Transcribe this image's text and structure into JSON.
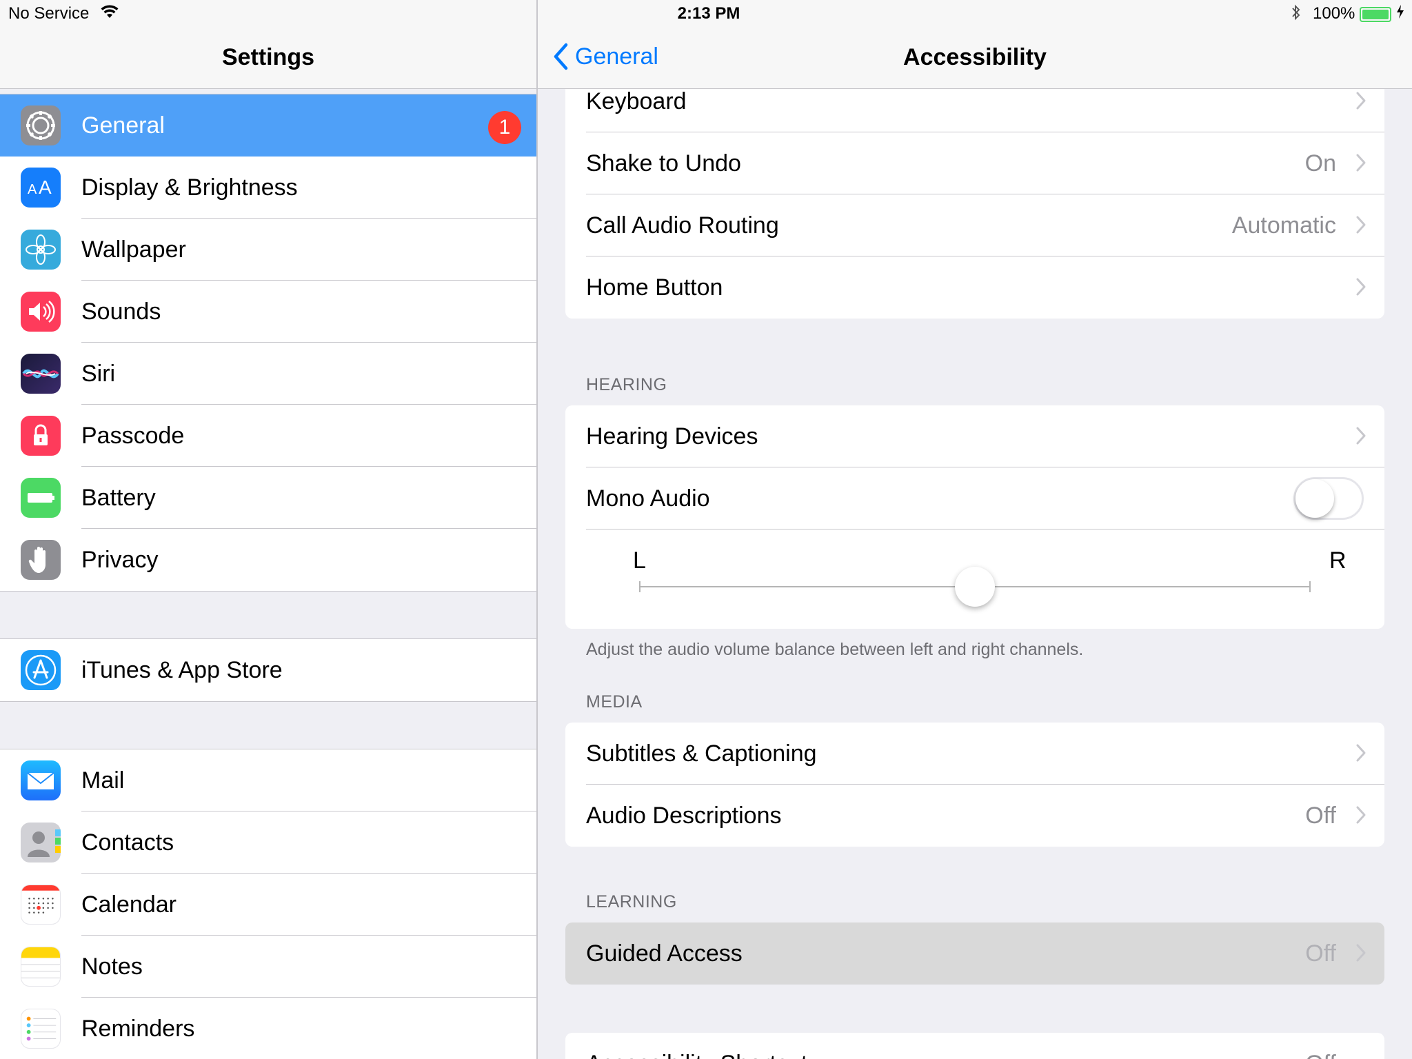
{
  "status_bar": {
    "carrier": "No Service",
    "time": "2:13 PM",
    "battery_percent": "100%",
    "battery_level": 1.0,
    "icons": [
      "wifi-icon",
      "bluetooth-icon",
      "battery-icon",
      "charging-icon"
    ]
  },
  "master": {
    "title": "Settings",
    "groups": [
      {
        "items": [
          {
            "label": "General",
            "icon": "gear-icon",
            "color": "#8e8e93",
            "badge": "1",
            "selected": true
          },
          {
            "label": "Display & Brightness",
            "icon": "text-size-icon",
            "color": "#157efb"
          },
          {
            "label": "Wallpaper",
            "icon": "flower-icon",
            "color": "#36aadc"
          },
          {
            "label": "Sounds",
            "icon": "speaker-icon",
            "color": "#fe3b5b"
          },
          {
            "label": "Siri",
            "icon": "siri-icon",
            "color": "#1a1a3a"
          },
          {
            "label": "Passcode",
            "icon": "lock-icon",
            "color": "#fe3b5b"
          },
          {
            "label": "Battery",
            "icon": "battery-icon",
            "color": "#4cd964"
          },
          {
            "label": "Privacy",
            "icon": "hand-icon",
            "color": "#8e8e93"
          }
        ]
      },
      {
        "items": [
          {
            "label": "iTunes & App Store",
            "icon": "app-store-icon",
            "color": "#1b9af7"
          }
        ]
      },
      {
        "items": [
          {
            "label": "Mail",
            "icon": "envelope-icon",
            "color": "#1e8cfa"
          },
          {
            "label": "Contacts",
            "icon": "contacts-icon",
            "color": "#a3a3a8"
          },
          {
            "label": "Calendar",
            "icon": "calendar-icon",
            "color": "#ffffff"
          },
          {
            "label": "Notes",
            "icon": "notes-icon",
            "color": "#ffd60a"
          },
          {
            "label": "Reminders",
            "icon": "reminders-icon",
            "color": "#ffffff"
          }
        ]
      }
    ]
  },
  "detail": {
    "back_label": "General",
    "title": "Accessibility",
    "top_card": [
      {
        "label": "Keyboard",
        "value": ""
      },
      {
        "label": "Shake to Undo",
        "value": "On"
      },
      {
        "label": "Call Audio Routing",
        "value": "Automatic"
      },
      {
        "label": "Home Button",
        "value": ""
      }
    ],
    "hearing": {
      "header": "HEARING",
      "devices_label": "Hearing Devices",
      "mono_audio_label": "Mono Audio",
      "mono_audio_on": false,
      "balance_left_label": "L",
      "balance_right_label": "R",
      "balance_value": 0.5,
      "footer": "Adjust the audio volume balance between left and right channels."
    },
    "media": {
      "header": "MEDIA",
      "items": [
        {
          "label": "Subtitles & Captioning",
          "value": ""
        },
        {
          "label": "Audio Descriptions",
          "value": "Off"
        }
      ]
    },
    "learning": {
      "header": "LEARNING",
      "items": [
        {
          "label": "Guided Access",
          "value": "Off",
          "highlighted": true
        }
      ]
    },
    "next_partial": {
      "label": "Accessibility Shortcut",
      "value": "Off"
    }
  }
}
